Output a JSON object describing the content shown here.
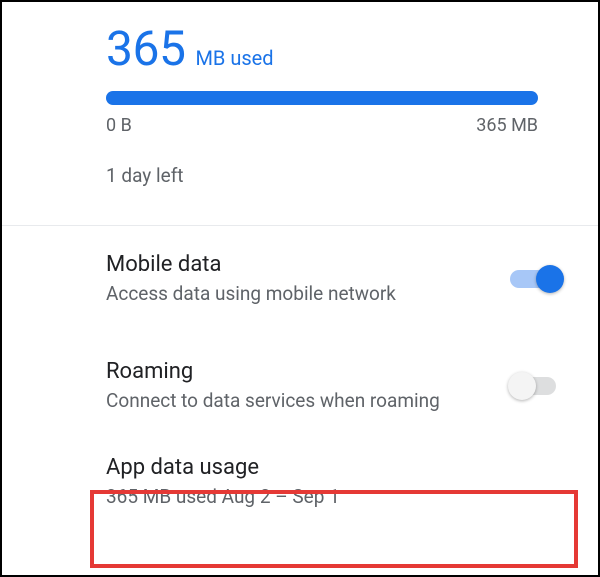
{
  "usage": {
    "amount": "365",
    "unit_used": "MB used",
    "progress_start": "0 B",
    "progress_end": "365 MB",
    "days_left": "1 day left"
  },
  "settings": {
    "mobile_data": {
      "title": "Mobile data",
      "subtitle": "Access data using mobile network",
      "on": true
    },
    "roaming": {
      "title": "Roaming",
      "subtitle": "Connect to data services when roaming",
      "on": false
    },
    "app_data_usage": {
      "title": "App data usage",
      "subtitle": "365 MB used Aug 2 – Sep 1"
    }
  }
}
